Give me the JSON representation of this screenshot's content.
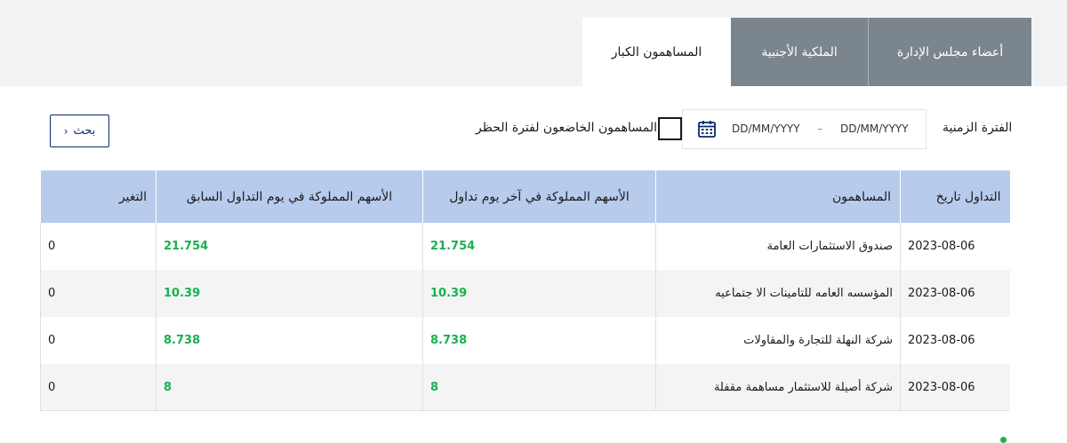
{
  "tabs": [
    {
      "label": "المساهمون الكبار",
      "active": true
    },
    {
      "label": "الملكية الأجنبية",
      "active": false
    },
    {
      "label": "أعضاء مجلس الإدارة",
      "active": false
    }
  ],
  "filters": {
    "period_label": "الفترة الزمنية",
    "date_from_placeholder": "DD/MM/YYYY",
    "date_separator": "–",
    "date_to_placeholder": "DD/MM/YYYY",
    "ban_checkbox_label": "المساهمون الخاضعون لفترة الحظر",
    "ban_checked": false,
    "search_label": "بحث",
    "search_chevron": "‹"
  },
  "table": {
    "headers": {
      "date": "التداول تاريخ",
      "shareholder": "المساهمون",
      "last_day": "الأسهم المملوكة في آخر يوم تداول",
      "prev_day": "الأسهم المملوكة في يوم التداول السابق",
      "change": "التغير"
    },
    "rows": [
      {
        "date": "2023-08-06",
        "shareholder": "صندوق الاستثمارات العامة",
        "last_day": "21.754",
        "prev_day": "21.754",
        "change": "0"
      },
      {
        "date": "2023-08-06",
        "shareholder": "المؤسسه العامه للتامينات الا جتماعيه",
        "last_day": "10.39",
        "prev_day": "10.39",
        "change": "0"
      },
      {
        "date": "2023-08-06",
        "shareholder": "شركة النهلة للتجارة والمقاولات",
        "last_day": "8.738",
        "prev_day": "8.738",
        "change": "0"
      },
      {
        "date": "2023-08-06",
        "shareholder": "شركة أصيلة للاستثمار مساهمة مقفلة",
        "last_day": "8",
        "prev_day": "8",
        "change": "0"
      }
    ]
  },
  "colors": {
    "accent_navy": "#0b2a6b",
    "positive_green": "#17b150",
    "header_blue": "#b7cbec",
    "tab_inactive": "#7b858d"
  },
  "icons": {
    "calendar": "calendar-icon",
    "chevron": "chevron-left-icon"
  }
}
